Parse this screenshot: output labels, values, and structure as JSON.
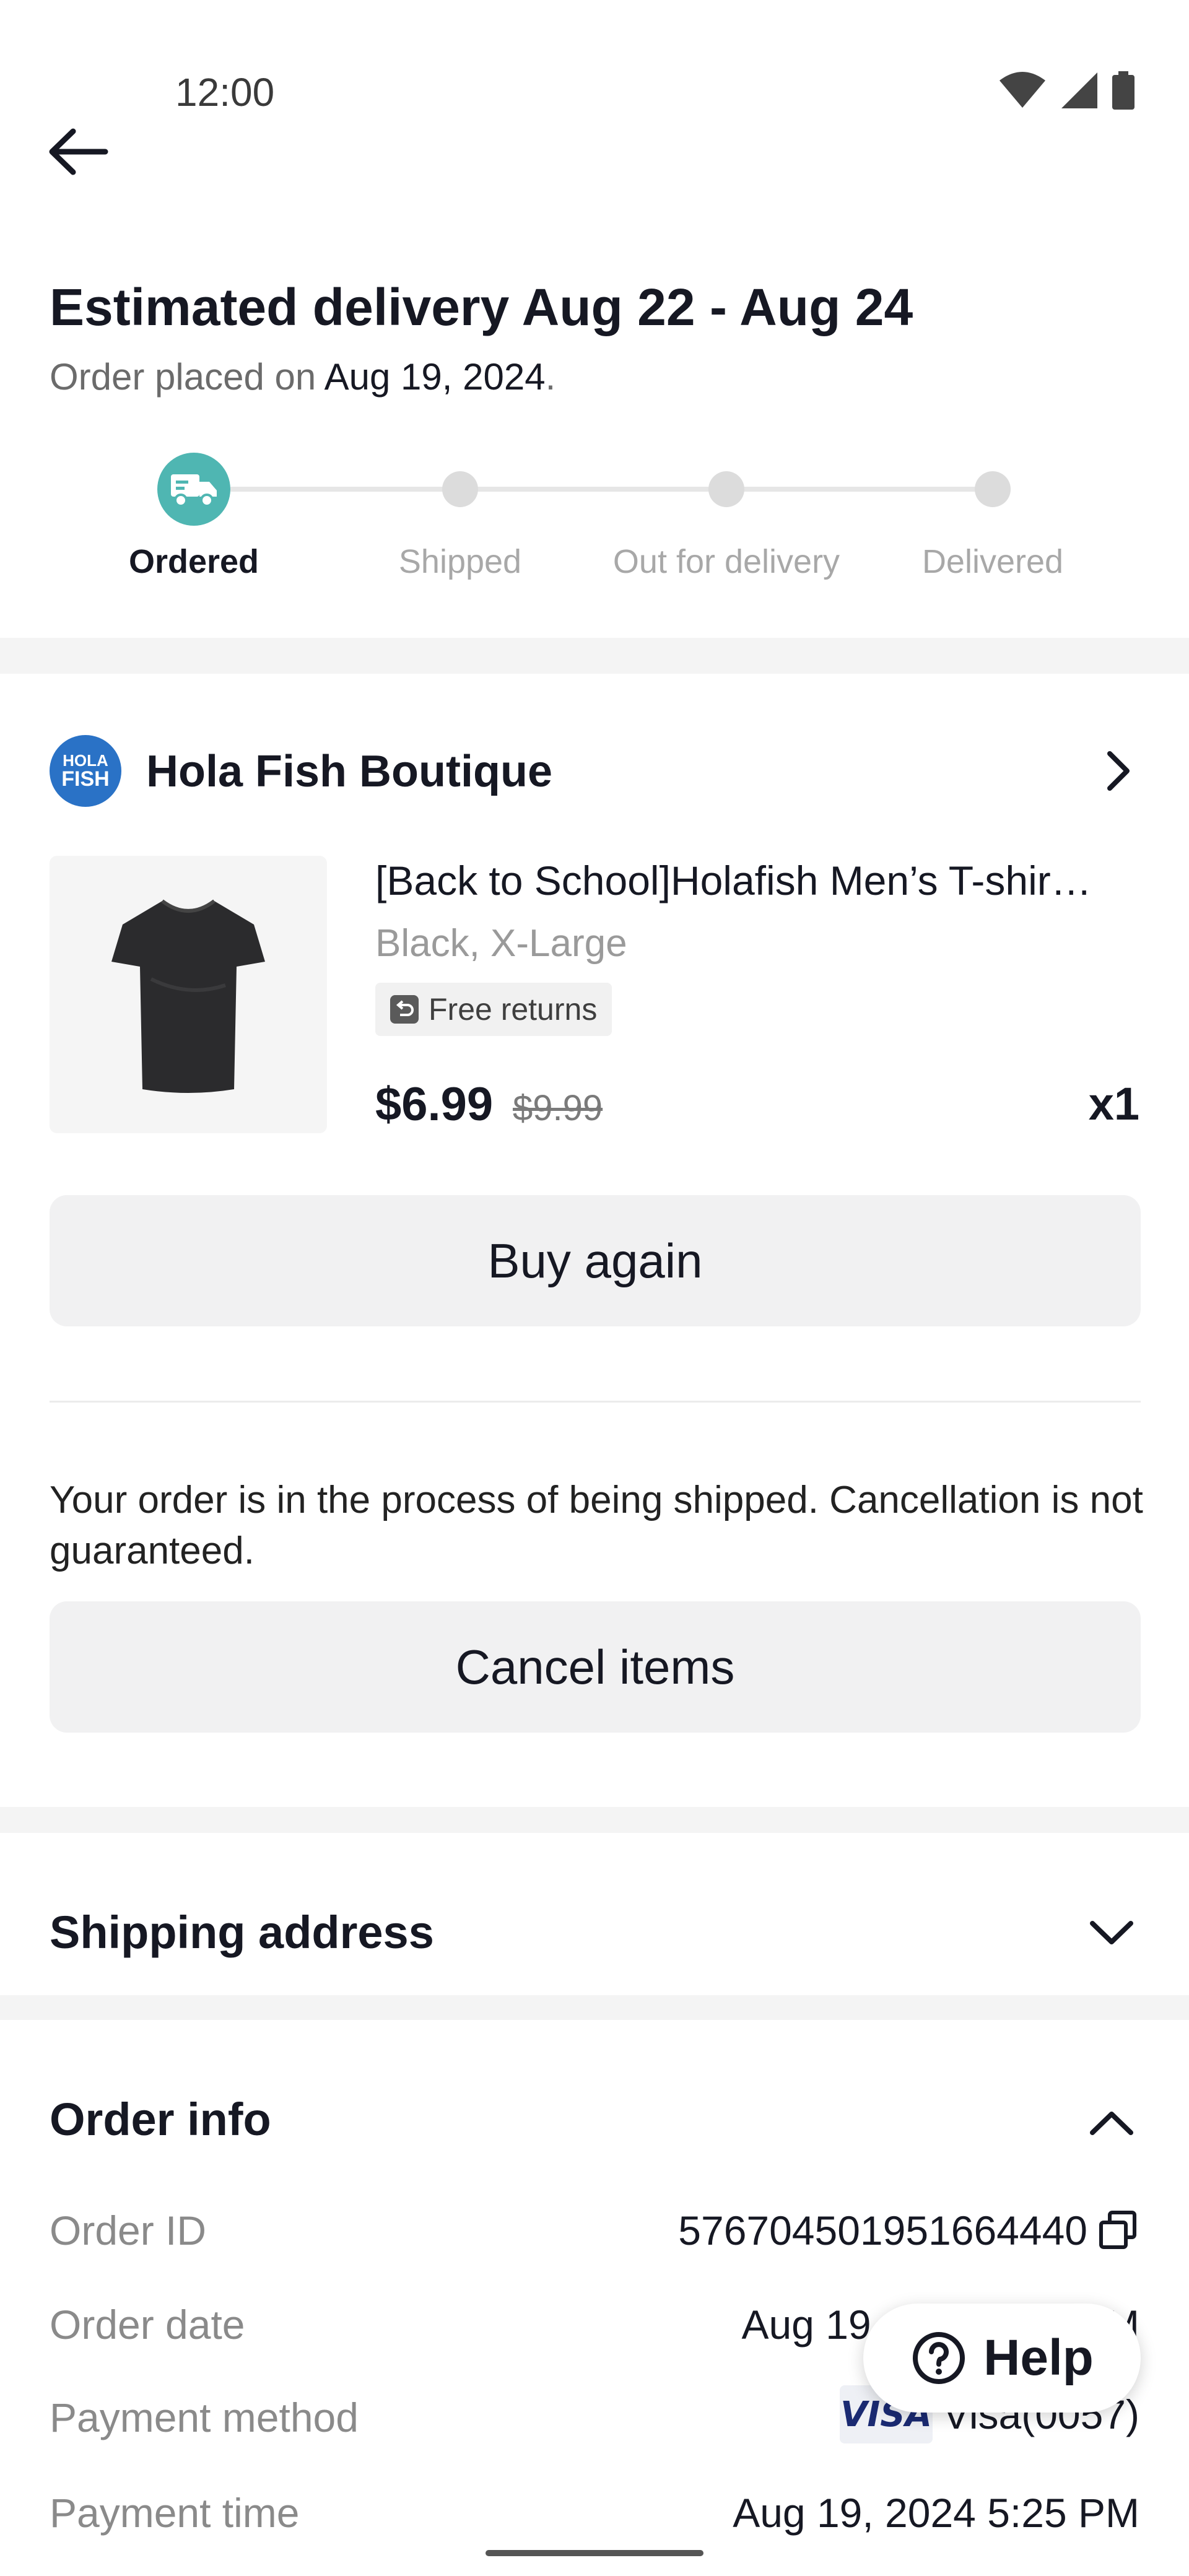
{
  "status_bar": {
    "time": "12:00"
  },
  "header": {
    "title": "Estimated delivery Aug 22 - Aug 24",
    "subtitle_prefix": "Order placed on ",
    "subtitle_date": "Aug 19, 2024",
    "subtitle_suffix": "."
  },
  "tracker": {
    "steps": [
      "Ordered",
      "Shipped",
      "Out for delivery",
      "Delivered"
    ],
    "active_step": "Ordered",
    "accent_color": "#4fb6b2"
  },
  "seller": {
    "logo_text_line1": "HOLA",
    "logo_text_line2": "FISH",
    "name": "Hola Fish Boutique"
  },
  "product": {
    "name": "[Back to School]Holafish Men’s T-shir…",
    "variant": "Black, X-Large",
    "badge": "Free returns",
    "price": "$6.99",
    "original_price": "$9.99",
    "quantity": "x1"
  },
  "actions": {
    "buy_again": "Buy again",
    "cancel_items": "Cancel items"
  },
  "notice": "Your order is in the process of being shipped. Cancellation is not guaranteed.",
  "shipping": {
    "title": "Shipping address"
  },
  "order_info": {
    "title": "Order info",
    "rows": [
      {
        "label": "Order ID",
        "value": "576704501951664440"
      },
      {
        "label": "Order date",
        "value": "Aug 19, 2"
      },
      {
        "label": "Payment method",
        "value": "Visa(0057)"
      },
      {
        "label": "Payment time",
        "value": "Aug 19, 2024 5:25 PM"
      }
    ],
    "card_brand": "VISA",
    "order_date_tail": "M"
  },
  "help": {
    "label": "Help"
  }
}
